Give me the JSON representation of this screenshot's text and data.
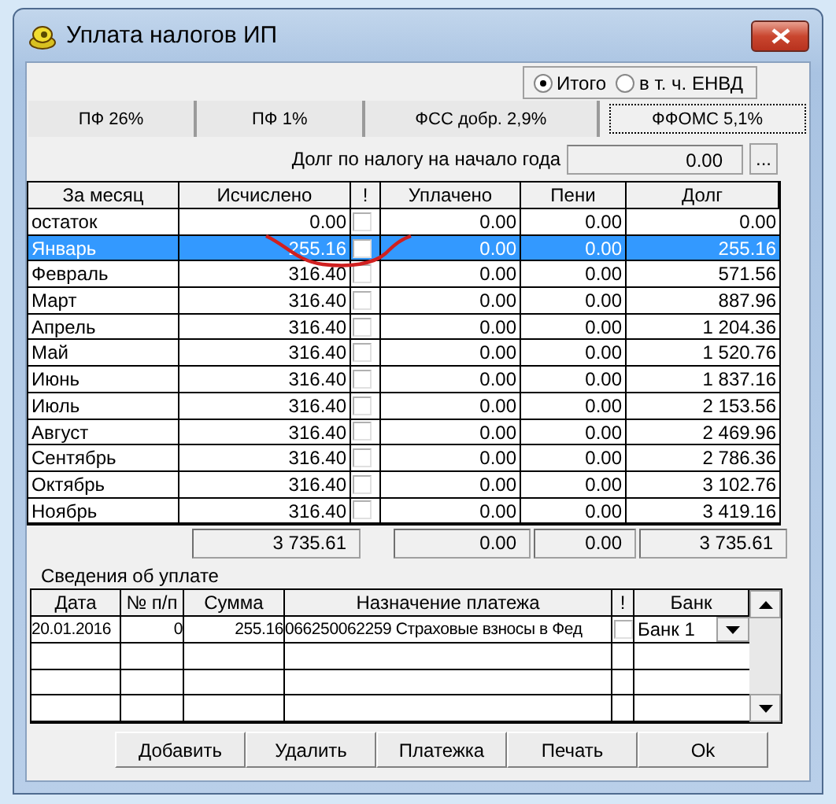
{
  "window": {
    "title": "Уплата налогов ИП"
  },
  "mode_options": [
    {
      "label": "Итого",
      "selected": true
    },
    {
      "label": "в т. ч. ЕНВД",
      "selected": false
    }
  ],
  "tabs": [
    {
      "label": "ПФ 26%",
      "selected": false
    },
    {
      "label": "ПФ 1%",
      "selected": false
    },
    {
      "label": "ФСС добр. 2,9%",
      "selected": false
    },
    {
      "label": "ФФОМС 5,1%",
      "selected": true
    }
  ],
  "opening_debt": {
    "label": "Долг по налогу на начало года",
    "value": "0.00",
    "button": "..."
  },
  "table": {
    "columns": [
      "За месяц",
      "Исчислено",
      "!",
      "Уплачено",
      "Пени",
      "Долг"
    ],
    "rows": [
      {
        "month": "остаток",
        "calculated": "0.00",
        "flag": false,
        "paid": "0.00",
        "penalty": "0.00",
        "debt": "0.00",
        "selected": false
      },
      {
        "month": "Январь",
        "calculated": "255.16",
        "flag": false,
        "paid": "0.00",
        "penalty": "0.00",
        "debt": "255.16",
        "selected": true
      },
      {
        "month": "Февраль",
        "calculated": "316.40",
        "flag": false,
        "paid": "0.00",
        "penalty": "0.00",
        "debt": "571.56",
        "selected": false
      },
      {
        "month": "Март",
        "calculated": "316.40",
        "flag": false,
        "paid": "0.00",
        "penalty": "0.00",
        "debt": "887.96",
        "selected": false
      },
      {
        "month": "Апрель",
        "calculated": "316.40",
        "flag": false,
        "paid": "0.00",
        "penalty": "0.00",
        "debt": "1 204.36",
        "selected": false
      },
      {
        "month": "Май",
        "calculated": "316.40",
        "flag": false,
        "paid": "0.00",
        "penalty": "0.00",
        "debt": "1 520.76",
        "selected": false
      },
      {
        "month": "Июнь",
        "calculated": "316.40",
        "flag": false,
        "paid": "0.00",
        "penalty": "0.00",
        "debt": "1 837.16",
        "selected": false
      },
      {
        "month": "Июль",
        "calculated": "316.40",
        "flag": false,
        "paid": "0.00",
        "penalty": "0.00",
        "debt": "2 153.56",
        "selected": false
      },
      {
        "month": "Август",
        "calculated": "316.40",
        "flag": false,
        "paid": "0.00",
        "penalty": "0.00",
        "debt": "2 469.96",
        "selected": false
      },
      {
        "month": "Сентябрь",
        "calculated": "316.40",
        "flag": false,
        "paid": "0.00",
        "penalty": "0.00",
        "debt": "2 786.36",
        "selected": false
      },
      {
        "month": "Октябрь",
        "calculated": "316.40",
        "flag": false,
        "paid": "0.00",
        "penalty": "0.00",
        "debt": "3 102.76",
        "selected": false
      },
      {
        "month": "Ноябрь",
        "calculated": "316.40",
        "flag": false,
        "paid": "0.00",
        "penalty": "0.00",
        "debt": "3 419.16",
        "selected": false
      }
    ],
    "totals": {
      "calculated": "3 735.61",
      "paid": "0.00",
      "penalty": "0.00",
      "debt": "3 735.61"
    }
  },
  "payments": {
    "title": "Сведения об уплате",
    "columns": [
      "Дата",
      "№ п/п",
      "Сумма",
      "Назначение платежа",
      "!",
      "Банк"
    ],
    "rows": [
      {
        "date": "20.01.2016",
        "number": "0",
        "sum": "255.16",
        "purpose": "066250062259 Страховые взносы  в Фед",
        "flag": false,
        "bank": "Банк 1"
      }
    ]
  },
  "buttons": [
    "Добавить",
    "Удалить",
    "Платежка",
    "Печать",
    "Ok"
  ]
}
